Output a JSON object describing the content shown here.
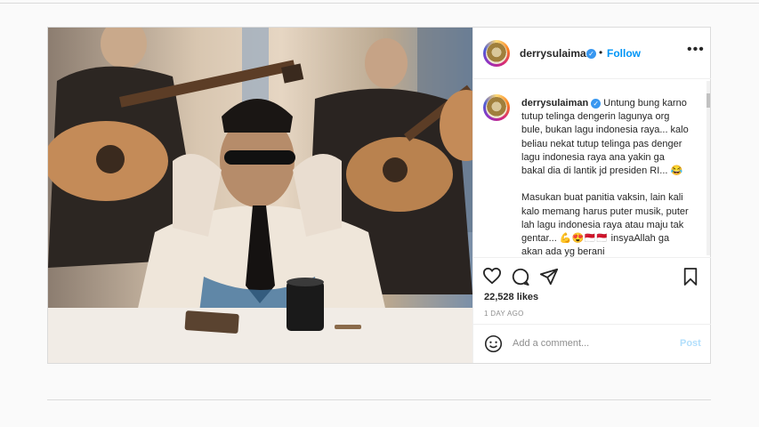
{
  "post": {
    "username": "derrysulaiman",
    "verified_icon": "verified-badge-icon",
    "separator": "•",
    "follow_label": "Follow",
    "more_label": "•••",
    "caption_paragraph_1": "Untung bung karno tutup telinga dengerin lagunya org bule, bukan lagu indonesia raya... kalo beliau nekat tutup telinga pas denger lagu indonesia raya ana yakin ga bakal dia di lantik jd presiden RI... 😂",
    "caption_paragraph_2": "Masukan buat panitia vaksin, lain kali kalo memang harus puter musik, puter lah lagu indonesia raya atau maju tak gentar... 💪😍🇲🇨🇲🇨 insyaAllah ga akan ada yg berani",
    "likes": "22,528 likes",
    "time": "1 DAY AGO",
    "comment_placeholder": "Add a comment...",
    "post_label": "Post"
  },
  "icons": {
    "like": "heart-icon",
    "comment": "comment-icon",
    "share": "send-icon",
    "save": "bookmark-icon",
    "emoji": "smiley-icon"
  },
  "colors": {
    "accent": "#0095f6",
    "post_disabled": "#b2dffc",
    "text": "#262626",
    "muted": "#8e8e8e",
    "border": "#dbdbdb"
  }
}
